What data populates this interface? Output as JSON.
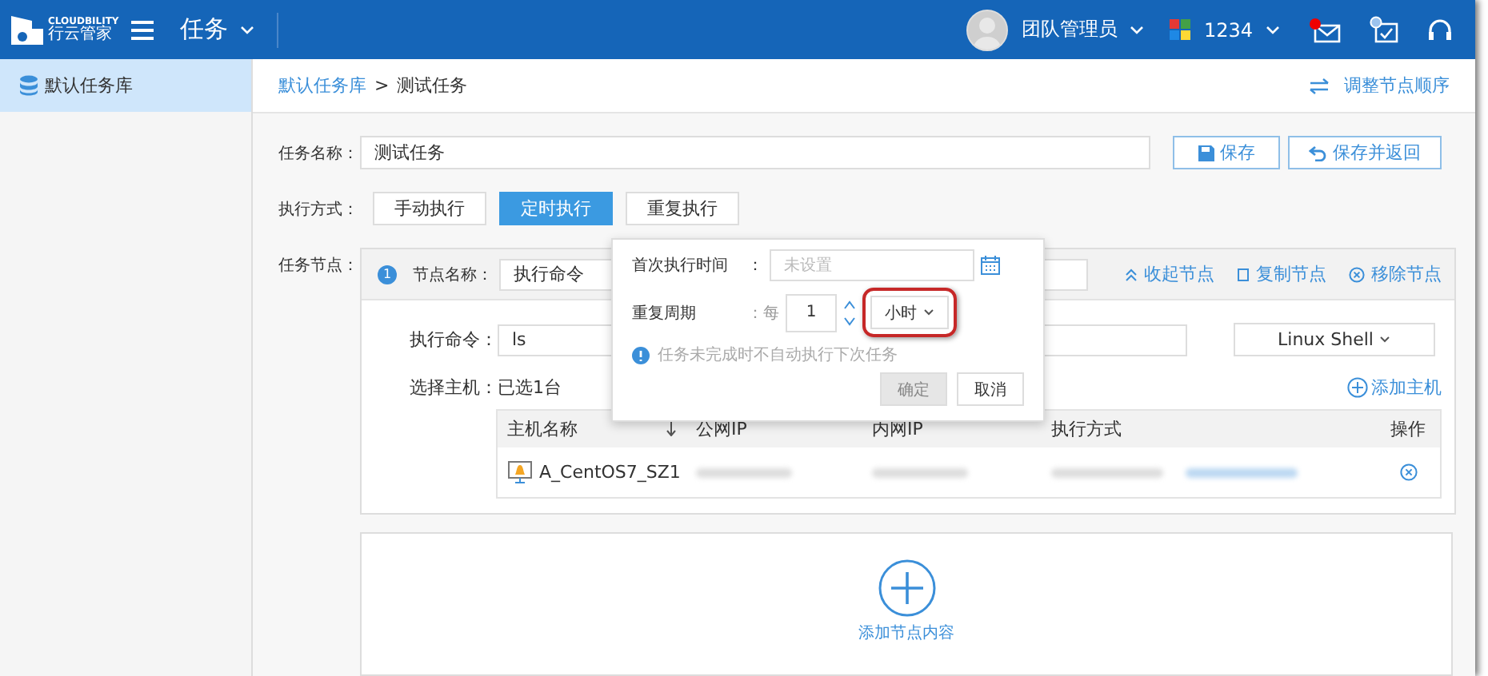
{
  "topbar": {
    "logo_text": "CLOUDBILITY",
    "logo_subtext": "行云管家",
    "module": "任务",
    "user": "团队管理员",
    "org": "1234",
    "mail_unread": true
  },
  "sidebar": {
    "items": [
      {
        "label": "默认任务库",
        "selected": true
      }
    ]
  },
  "breadcrumb": {
    "parent": "默认任务库",
    "separator": ">",
    "current": "测试任务",
    "reorder_link": "调整节点顺序"
  },
  "task_name": {
    "label": "任务名称：",
    "value": "测试任务"
  },
  "buttons": {
    "save": "保存",
    "save_return": "保存并返回"
  },
  "exec_mode": {
    "label": "执行方式：",
    "options": [
      {
        "label": "手动执行",
        "selected": false
      },
      {
        "label": "定时执行",
        "selected": true
      },
      {
        "label": "重复执行",
        "selected": false
      }
    ]
  },
  "node": {
    "label": "任务节点：",
    "index": "1",
    "name_label": "节点名称：",
    "name_value": "执行命令",
    "actions": [
      {
        "kind": "collapse",
        "label": "收起节点"
      },
      {
        "kind": "copy",
        "label": "复制节点"
      },
      {
        "kind": "remove",
        "label": "移除节点"
      }
    ],
    "command_label": "执行命令：",
    "command_value": "ls",
    "shell": "Linux Shell",
    "host_label": "选择主机：",
    "host_count": "已选1台",
    "add_host": "添加主机",
    "table": {
      "columns": [
        {
          "label": "主机名称",
          "sortable": true
        },
        {
          "label": "公网IP",
          "sortable": false
        },
        {
          "label": "内网IP",
          "sortable": false
        },
        {
          "label": "执行方式",
          "sortable": false
        },
        {
          "label": "操作",
          "sortable": false
        }
      ],
      "rows": [
        {
          "name": "A_CentOS7_SZ1"
        }
      ]
    }
  },
  "add_node": {
    "label": "添加节点内容"
  },
  "popup": {
    "first_time_label": "首次执行时间",
    "first_time_colon": "：",
    "first_time_placeholder": "未设置",
    "period_label": "重复周期",
    "every": "：每",
    "count": "1",
    "unit": "小时",
    "hint": "任务未完成时不自动执行下次任务",
    "confirm": {
      "label": "确定",
      "disabled": true
    },
    "cancel": "取消"
  }
}
